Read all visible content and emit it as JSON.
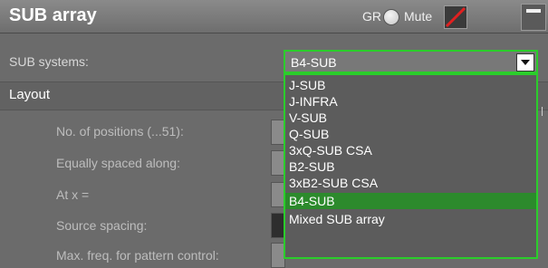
{
  "header": {
    "title": "SUB array",
    "gr_label": "GR",
    "mute_label": "Mute"
  },
  "sub_systems": {
    "label": "SUB systems:",
    "selected": "B4-SUB",
    "options": [
      "J-SUB",
      "J-INFRA",
      "V-SUB",
      "Q-SUB",
      "3xQ-SUB CSA",
      "B2-SUB",
      "3xB2-SUB CSA",
      "B4-SUB",
      "Mixed SUB array"
    ]
  },
  "layout": {
    "label": "Layout",
    "fields": [
      {
        "label": "No. of positions (...51):"
      },
      {
        "label": "Equally spaced along:"
      },
      {
        "label": "At x ="
      },
      {
        "label": "Source spacing:"
      },
      {
        "label": "Max. freq. for pattern control:"
      }
    ]
  },
  "colors": {
    "accent": "#2bcd2b",
    "selected_option": "#2c8a2c",
    "mute_slash": "#e02020"
  },
  "icons": [
    "minimize-icon",
    "radio-icon",
    "mute-slash-icon",
    "chevron-down-icon"
  ]
}
